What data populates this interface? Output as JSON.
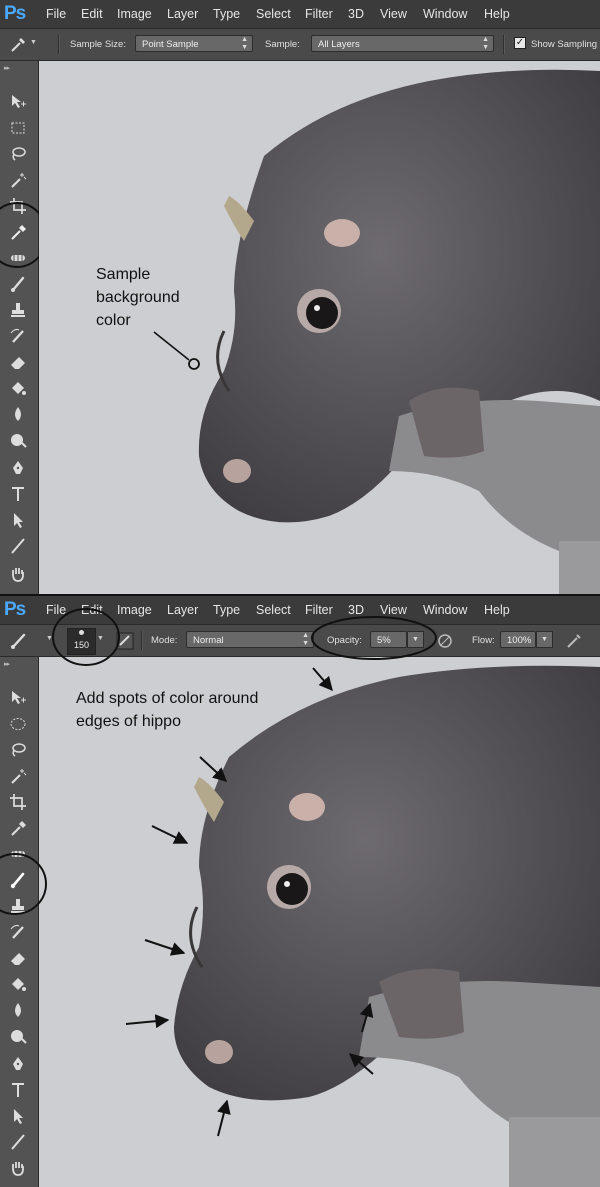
{
  "app": {
    "logo": "Ps"
  },
  "menu": [
    "File",
    "Edit",
    "Image",
    "Layer",
    "Type",
    "Select",
    "Filter",
    "3D",
    "View",
    "Window",
    "Help"
  ],
  "panel1": {
    "options": {
      "sample_size_label": "Sample Size:",
      "sample_size_value": "Point Sample",
      "sample_label": "Sample:",
      "sample_value": "All Layers",
      "show_sampling_label": "Show Sampling"
    },
    "annotation": [
      "Sample",
      "background",
      "color"
    ]
  },
  "panel2": {
    "options": {
      "brush_size": "150",
      "mode_label": "Mode:",
      "mode_value": "Normal",
      "opacity_label": "Opacity:",
      "opacity_value": "5%",
      "flow_label": "Flow:",
      "flow_value": "100%"
    },
    "annotation": [
      "Add spots of color around",
      "edges of hippo"
    ]
  },
  "colors": {
    "canvas_bg": "#cdced2",
    "ui_dark": "#3b3b3b",
    "ps_blue": "#4aa8ff",
    "hippo": "#5d5a5f"
  },
  "icons": [
    "eyedropper-icon",
    "brush-icon",
    "move-icon",
    "marquee-icon",
    "lasso-icon",
    "magic-wand-icon",
    "crop-icon",
    "healing-icon",
    "stamp-icon",
    "history-brush-icon",
    "eraser-icon",
    "paint-bucket-icon",
    "blur-icon",
    "dodge-icon",
    "pen-icon",
    "type-icon",
    "path-select-icon",
    "line-icon",
    "hand-icon"
  ]
}
